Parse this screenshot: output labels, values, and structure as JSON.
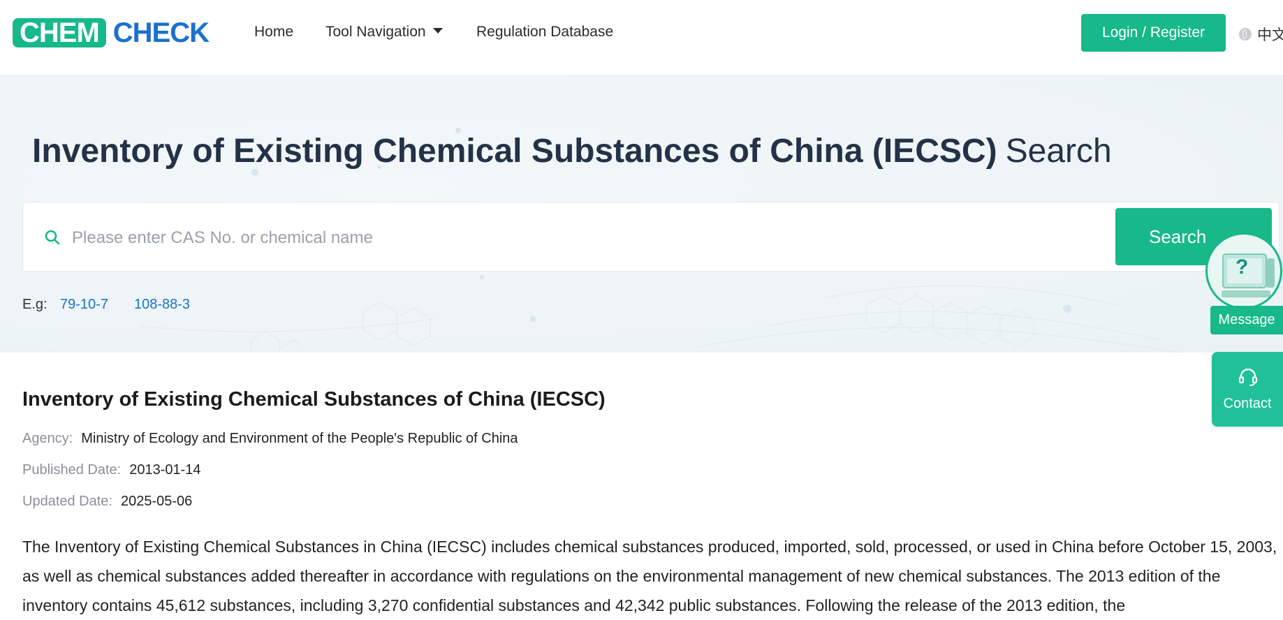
{
  "header": {
    "logo_part1": "CHEM",
    "logo_part2": "CHECK",
    "nav": [
      {
        "label": "Home"
      },
      {
        "label": "Tool Navigation"
      },
      {
        "label": "Regulation Database"
      }
    ],
    "login_label": "Login / Register",
    "language": "中文"
  },
  "hero": {
    "title_main": "Inventory of Existing Chemical Substances of China (IECSC)",
    "title_suffix": "Search",
    "search_placeholder": "Please enter CAS No. or chemical name",
    "search_button": "Search",
    "search_arrow": "→",
    "examples_label": "E.g:",
    "examples": [
      "79-10-7",
      "108-88-3"
    ]
  },
  "floating": {
    "help_symbol": "?",
    "message_label": "Message",
    "contact_label": "Contact"
  },
  "info": {
    "title": "Inventory of Existing Chemical Substances of China (IECSC)",
    "agency_label": "Agency:",
    "agency_value": "Ministry of Ecology and Environment of the People's Republic of China",
    "published_label": "Published Date:",
    "published_value": "2013-01-14",
    "updated_label": "Updated Date:",
    "updated_value": "2025-05-06",
    "description": "The Inventory of Existing Chemical Substances in China (IECSC) includes chemical substances produced, imported, sold, processed, or used in China before October 15, 2003, as well as chemical substances added thereafter in accordance with regulations on the environmental management of new chemical substances. The 2013 edition of the inventory contains 45,612 substances, including 3,270 confidential substances and 42,342 public substances. Following the release of the 2013 edition, the"
  },
  "colors": {
    "brand_green": "#17b88a",
    "brand_blue": "#1a6fd1",
    "highlight_orange": "#f7912e",
    "link_blue": "#1a73c9"
  }
}
